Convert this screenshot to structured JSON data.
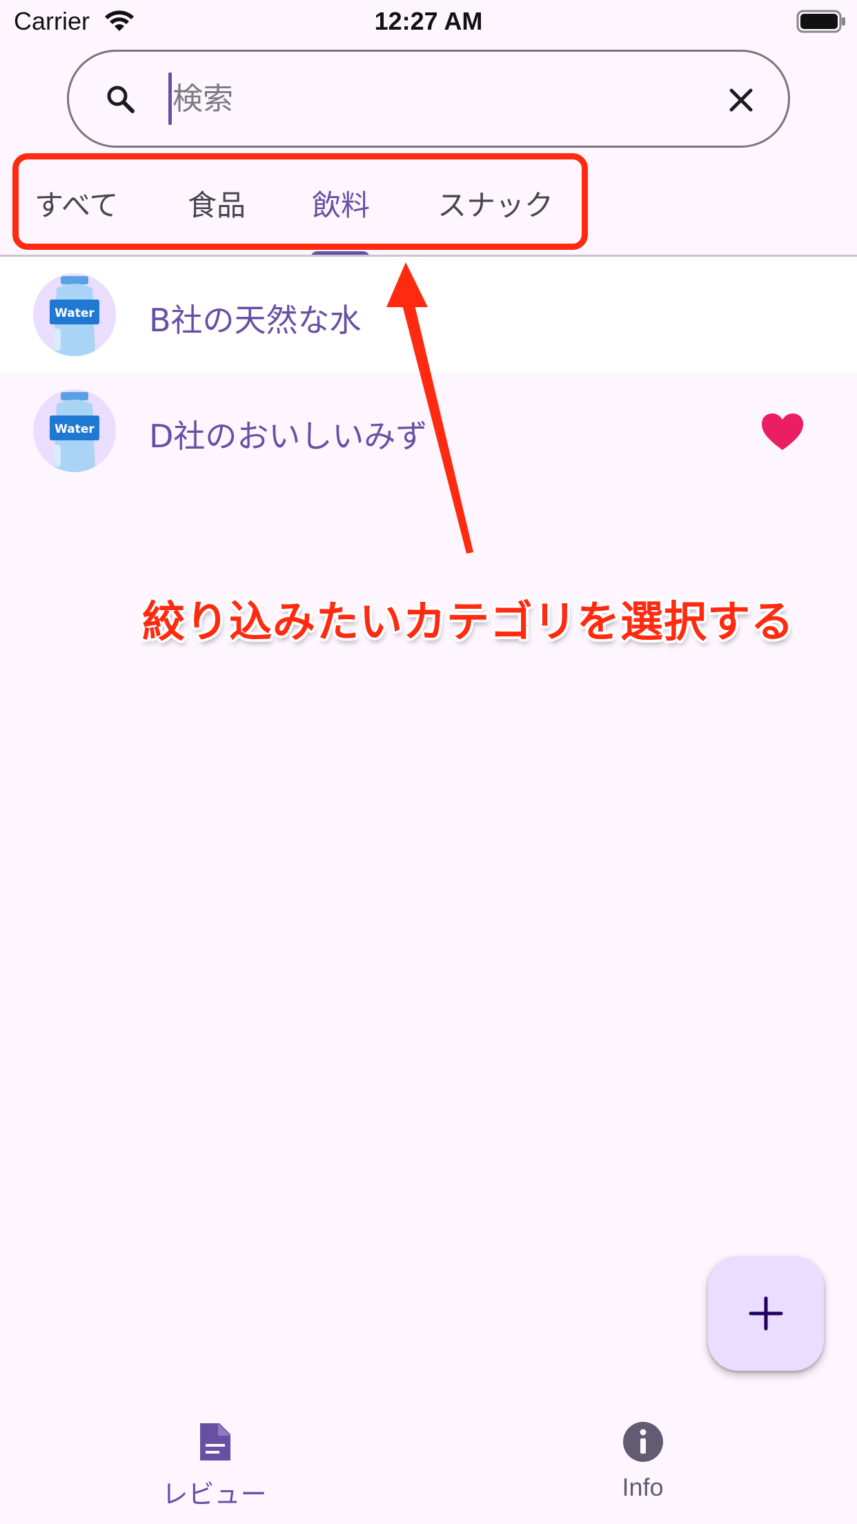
{
  "status_bar": {
    "carrier": "Carrier",
    "time": "12:27 AM"
  },
  "search": {
    "placeholder": "検索",
    "value": ""
  },
  "tabs": [
    {
      "label": "すべて",
      "selected": false
    },
    {
      "label": "食品",
      "selected": false
    },
    {
      "label": "飲料",
      "selected": true
    },
    {
      "label": "スナック",
      "selected": false
    }
  ],
  "items": [
    {
      "name": "B社の天然な水",
      "favorite": false,
      "image_text": "Water"
    },
    {
      "name": "D社のおいしいみず",
      "favorite": true,
      "image_text": "Water"
    }
  ],
  "annotation": {
    "text": "絞り込みたいカテゴリを選択する"
  },
  "fab": {
    "icon": "add-icon"
  },
  "bottom_nav": [
    {
      "label": "レビュー",
      "icon": "document-icon",
      "selected": true
    },
    {
      "label": "Info",
      "icon": "info-icon",
      "selected": false
    }
  ],
  "colors": {
    "primary": "#6750a4",
    "background": "#fdf6fe",
    "annotation": "#ff2a0f",
    "favorite": "#e91e63",
    "fab": "#eaddff"
  }
}
